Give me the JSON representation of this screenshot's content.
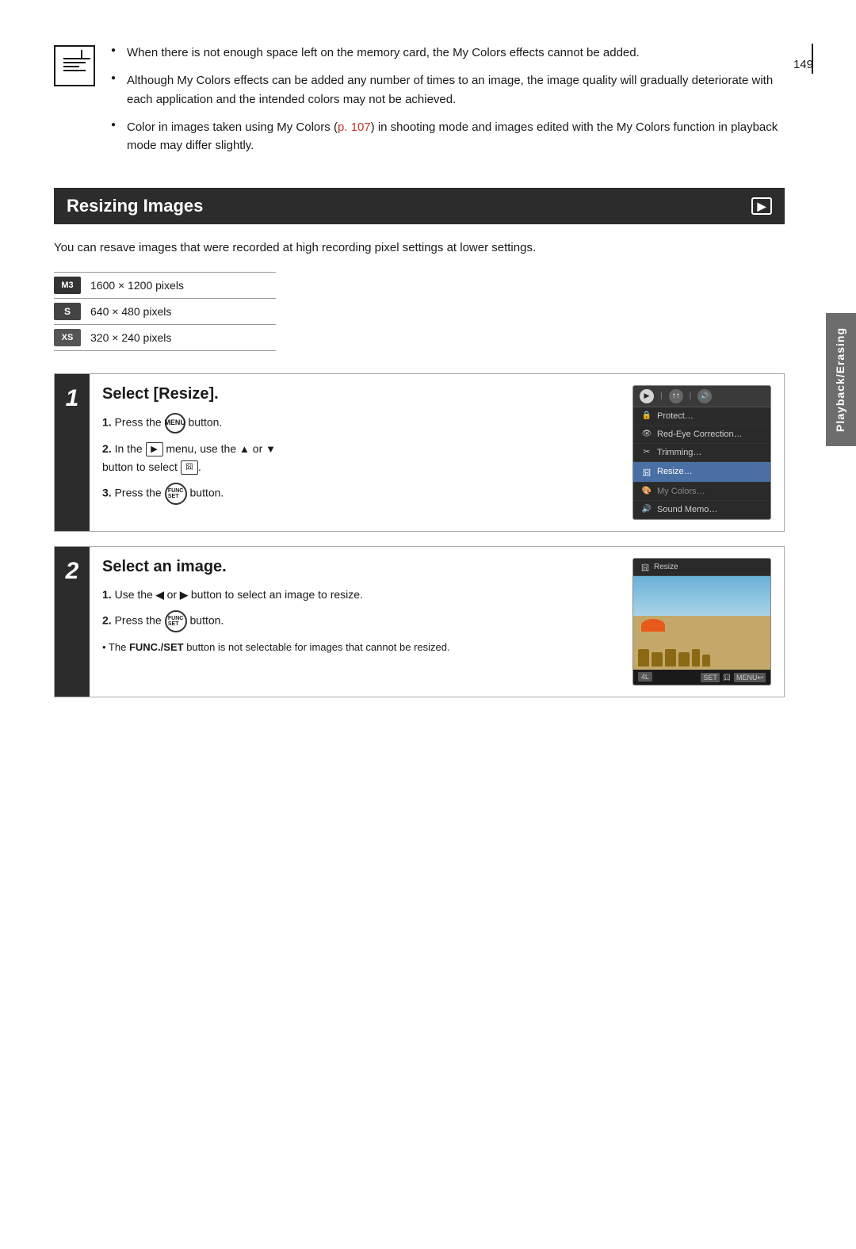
{
  "page": {
    "number": "149",
    "side_tab": "Playback/Erasing"
  },
  "notes": {
    "items": [
      "When there is not enough space left on the memory card, the My Colors effects cannot be added.",
      "Although My Colors effects can be added any number of times to an image, the image quality will gradually deteriorate with each application and the intended colors may not be achieved.",
      "Color in images taken using My Colors (p. 107) in shooting mode and images edited with the My Colors function in playback mode may differ slightly."
    ],
    "link_text": "p. 107"
  },
  "section": {
    "title": "Resizing Images",
    "intro": "You can resave images that were recorded at high recording pixel settings at lower settings.",
    "resolutions": [
      {
        "badge": "M3",
        "badge_class": "m3",
        "text": "1600 × 1200 pixels"
      },
      {
        "badge": "S",
        "badge_class": "s",
        "text": "640 × 480 pixels"
      },
      {
        "badge": "XS",
        "badge_class": "xs",
        "text": "320 × 240 pixels"
      }
    ]
  },
  "steps": [
    {
      "number": "1",
      "title": "Select [Resize].",
      "instructions": [
        "1. Press the MENU button.",
        "2. In the ▶ menu, use the ▲ or ▼ button to select 囧.",
        "3. Press the FUNC/SET button."
      ],
      "screen": {
        "type": "menu",
        "tabs": [
          "▶",
          "↑",
          "🔊"
        ],
        "menu_items": [
          {
            "icon": "🔒",
            "label": "Protect…",
            "selected": false,
            "dimmed": false
          },
          {
            "icon": "👁",
            "label": "Red-Eye Correction…",
            "selected": false,
            "dimmed": false
          },
          {
            "icon": "✂",
            "label": "Trimming…",
            "selected": false,
            "dimmed": false
          },
          {
            "icon": "囧",
            "label": "Resize…",
            "selected": true,
            "dimmed": false
          },
          {
            "icon": "🎨",
            "label": "My Colors…",
            "selected": false,
            "dimmed": true
          },
          {
            "icon": "🔊",
            "label": "Sound Memo…",
            "selected": false,
            "dimmed": false
          }
        ]
      }
    },
    {
      "number": "2",
      "title": "Select an image.",
      "instructions": [
        "1. Use the ← or → button to select an image to resize.",
        "2. Press the FUNC/SET button."
      ],
      "note": "• The FUNC./SET button is not selectable for images that cannot be resized.",
      "screen": {
        "type": "image",
        "title": "囧 Resize",
        "bottom_left": "4L",
        "bottom_right": "SET 囧 MENU↩"
      }
    }
  ]
}
